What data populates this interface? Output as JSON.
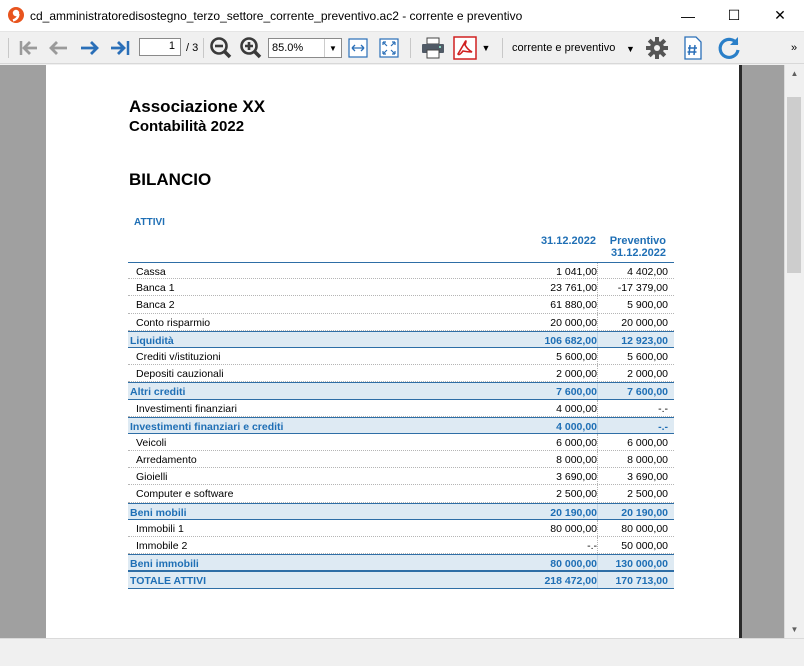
{
  "window": {
    "title": "cd_amministratoredisostegno_terzo_settore_corrente_preventivo.ac2 - corrente e preventivo",
    "minimize_glyph": "—",
    "maximize_glyph": "☐",
    "close_glyph": "✕"
  },
  "toolbar": {
    "page_current": "1",
    "page_total": "/ 3",
    "zoom_value": "85.0%",
    "view_name": "corrente e preventivo",
    "more_glyph": "»"
  },
  "icons": {
    "first": "arrow-first-icon",
    "prev": "arrow-left-icon",
    "next": "arrow-right-icon",
    "last": "arrow-last-icon",
    "zoom_out": "zoom-out-icon",
    "zoom_in": "zoom-in-icon",
    "fit_width": "fit-width-icon",
    "fit_page": "fit-page-icon",
    "print": "printer-icon",
    "pdf": "pdf-icon",
    "settings": "gear-icon",
    "hash": "hash-document-icon",
    "refresh": "refresh-icon"
  },
  "colors": {
    "accent": "#1f6fb5",
    "total_bg": "#deeaf3",
    "logo": "#e8541e"
  },
  "report": {
    "organization": "Associazione XX",
    "subtitle": "Contabilità 2022",
    "title": "BILANCIO",
    "section": "ATTIVI",
    "col1": "31.12.2022",
    "col2_line1": "Preventivo",
    "col2_line2": "31.12.2022",
    "rows": [
      {
        "label": "Cassa",
        "v1": "1 041,00",
        "v2": "4 402,00",
        "total": false
      },
      {
        "label": "Banca 1",
        "v1": "23 761,00",
        "v2": "-17 379,00",
        "total": false
      },
      {
        "label": "Banca 2",
        "v1": "61 880,00",
        "v2": "5 900,00",
        "total": false
      },
      {
        "label": "Conto risparmio",
        "v1": "20 000,00",
        "v2": "20 000,00",
        "total": false
      },
      {
        "label": "Liquidità",
        "v1": "106 682,00",
        "v2": "12 923,00",
        "total": true
      },
      {
        "label": "Crediti v/istituzioni",
        "v1": "5 600,00",
        "v2": "5 600,00",
        "total": false
      },
      {
        "label": "Depositi cauzionali",
        "v1": "2 000,00",
        "v2": "2 000,00",
        "total": false
      },
      {
        "label": "Altri crediti",
        "v1": "7 600,00",
        "v2": "7 600,00",
        "total": true
      },
      {
        "label": "Investimenti finanziari",
        "v1": "4 000,00",
        "v2": "-.-",
        "total": false
      },
      {
        "label": "Investimenti finanziari e crediti",
        "v1": "4 000,00",
        "v2": "-.-",
        "total": true
      },
      {
        "label": "Veicoli",
        "v1": "6 000,00",
        "v2": "6 000,00",
        "total": false
      },
      {
        "label": "Arredamento",
        "v1": "8 000,00",
        "v2": "8 000,00",
        "total": false
      },
      {
        "label": "Gioielli",
        "v1": "3 690,00",
        "v2": "3 690,00",
        "total": false
      },
      {
        "label": "Computer e software",
        "v1": "2 500,00",
        "v2": "2 500,00",
        "total": false
      },
      {
        "label": "Beni mobili",
        "v1": "20 190,00",
        "v2": "20 190,00",
        "total": true
      },
      {
        "label": "Immobili 1",
        "v1": "80 000,00",
        "v2": "80 000,00",
        "total": false
      },
      {
        "label": "Immobile 2",
        "v1": "-.-",
        "v2": "50 000,00",
        "total": false
      },
      {
        "label": "Beni immobili",
        "v1": "80 000,00",
        "v2": "130 000,00",
        "total": true
      },
      {
        "label": "TOTALE ATTIVI",
        "v1": "218 472,00",
        "v2": "170 713,00",
        "total": true
      }
    ]
  }
}
